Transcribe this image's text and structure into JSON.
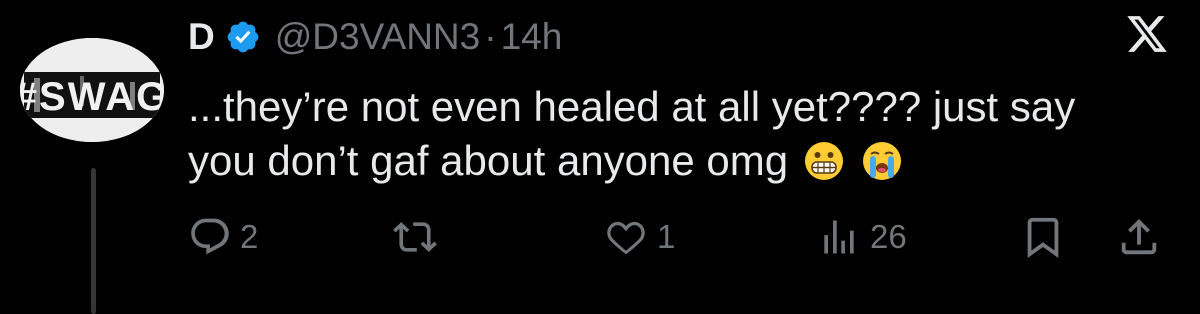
{
  "author": {
    "display_name": "D",
    "handle": "@D3VANN3",
    "separator": "·",
    "time": "14h",
    "verified": true,
    "avatar_text": "#SWAG"
  },
  "tweet": {
    "lines": [
      "...they’re not even healed at all yet???? just say",
      "you don’t gaf about anyone omg"
    ],
    "emojis": [
      "grimacing-face-emoji",
      "loudly-crying-face-emoji"
    ]
  },
  "actions": {
    "replies": "2",
    "retweets": "",
    "likes": "1",
    "views": "26"
  },
  "colors": {
    "background": "#000000",
    "text": "#e7e9ea",
    "muted": "#71767b",
    "verified_blue": "#1d9bf0"
  },
  "icons": [
    "verified-badge-icon",
    "x-logo-icon",
    "reply-icon",
    "retweet-icon",
    "like-icon",
    "views-icon",
    "bookmark-icon",
    "share-icon"
  ]
}
